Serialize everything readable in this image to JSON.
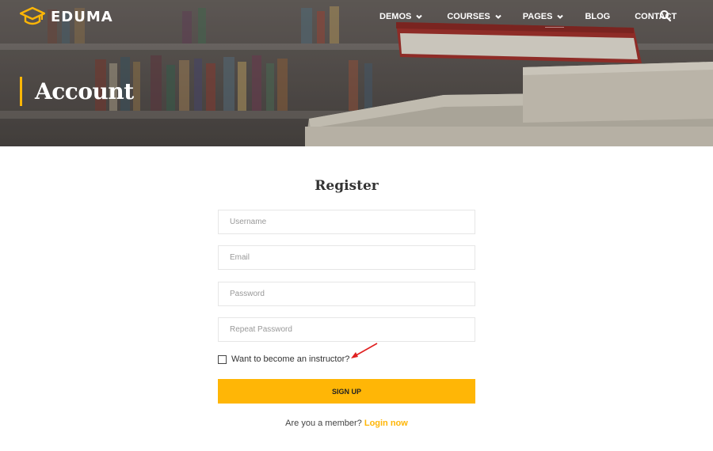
{
  "brand": {
    "name": "EDUMA",
    "accent": "#ffb606"
  },
  "nav": {
    "items": [
      {
        "label": "DEMOS",
        "dropdown": true
      },
      {
        "label": "COURSES",
        "dropdown": true
      },
      {
        "label": "PAGES",
        "dropdown": true
      },
      {
        "label": "BLOG",
        "dropdown": false
      },
      {
        "label": "CONTACT",
        "dropdown": false
      }
    ],
    "search_icon": "search-icon"
  },
  "hero": {
    "title": "Account"
  },
  "register": {
    "title": "Register",
    "fields": {
      "username": {
        "placeholder": "Username",
        "value": ""
      },
      "email": {
        "placeholder": "Email",
        "value": ""
      },
      "password": {
        "placeholder": "Password",
        "value": ""
      },
      "repeat_password": {
        "placeholder": "Repeat Password",
        "value": ""
      }
    },
    "instructor_checkbox": {
      "label": "Want to become an instructor?",
      "checked": false
    },
    "submit_label": "SIGN UP",
    "member_text": "Are you a member?",
    "login_link": "Login now"
  },
  "annotation": {
    "arrow_color": "#e02020"
  }
}
